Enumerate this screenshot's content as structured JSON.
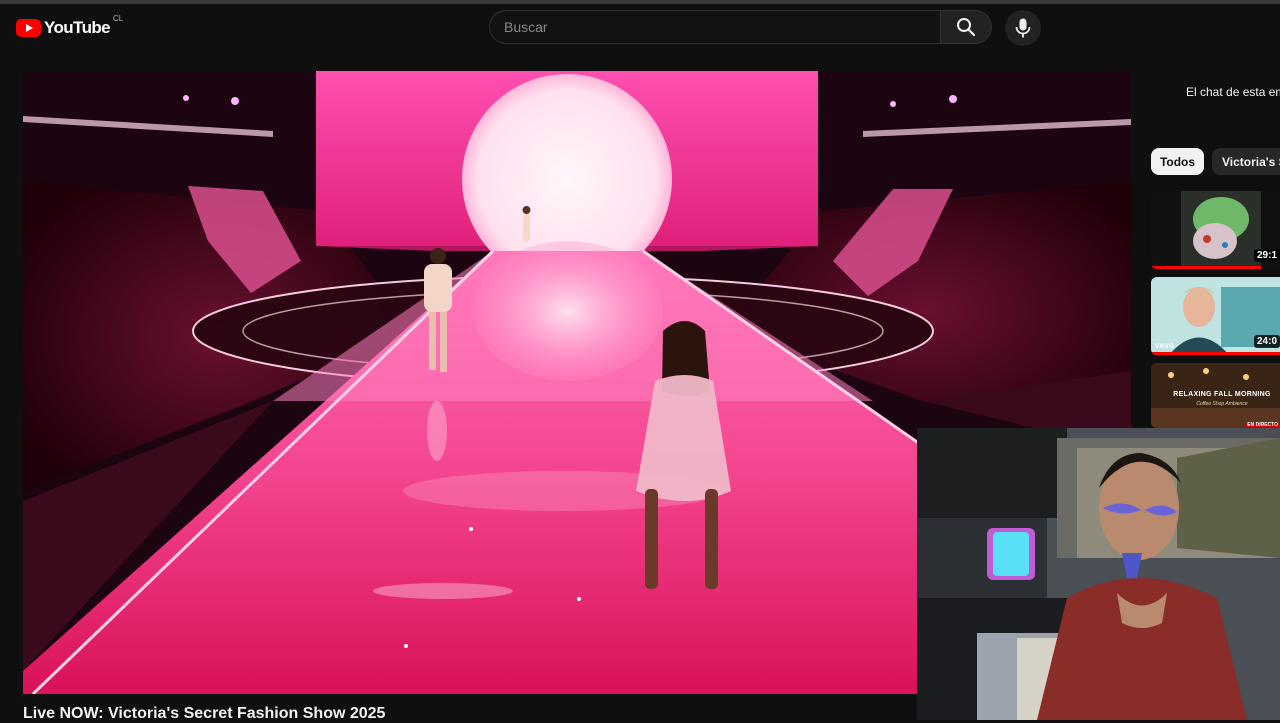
{
  "header": {
    "logo_text": "YouTube",
    "country_code": "CL",
    "search_placeholder": "Buscar"
  },
  "video": {
    "title": "Live NOW: Victoria's Secret Fashion Show 2025"
  },
  "sidebar": {
    "chat_notice": "El chat de esta em",
    "chips": [
      {
        "label": "Todos",
        "active": true
      },
      {
        "label": "Victoria's Se",
        "active": false
      }
    ],
    "recommendations": [
      {
        "duration": "29:1",
        "progress_fraction": 0.85
      },
      {
        "duration": "24:0",
        "tag": "vevo",
        "progress_fraction": 1.0
      },
      {
        "title_text": "RELAXING FALL MORNING",
        "subtitle_text": "Coffee Shop Ambience",
        "badge": "EN DIRECTO"
      }
    ]
  },
  "colors": {
    "background": "#0f0f0f",
    "brand_red": "#ff0000",
    "runway_pink": "#ff5fa8",
    "text": "#f1f1f1"
  },
  "icons": [
    "youtube-logo-icon",
    "search-icon",
    "microphone-icon"
  ]
}
